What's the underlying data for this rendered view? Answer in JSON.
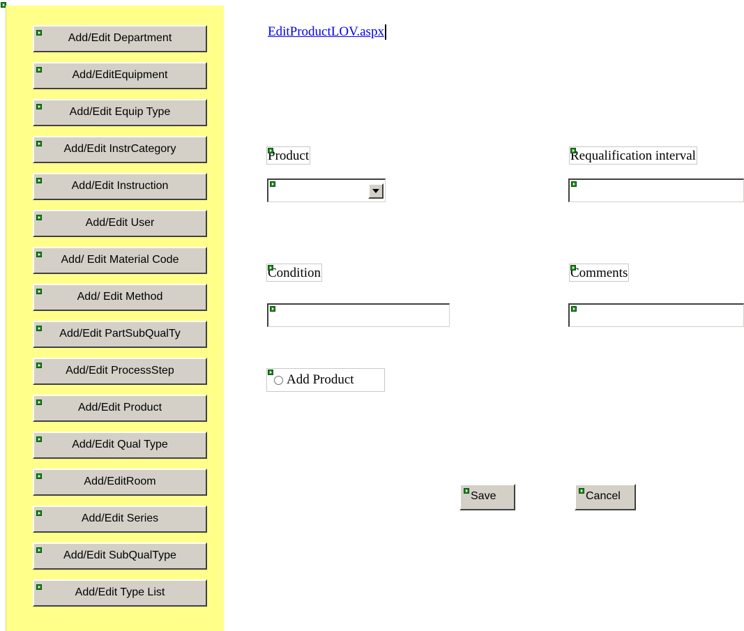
{
  "sidebar": {
    "items": [
      {
        "label": "Add/Edit Department"
      },
      {
        "label": "Add/EditEquipment"
      },
      {
        "label": "Add/Edit Equip Type"
      },
      {
        "label": "Add/Edit InstrCategory"
      },
      {
        "label": "Add/Edit Instruction"
      },
      {
        "label": "Add/Edit User"
      },
      {
        "label": "Add/ Edit Material Code"
      },
      {
        "label": "Add/ Edit Method"
      },
      {
        "label": "Add/Edit PartSubQualTy"
      },
      {
        "label": "Add/Edit ProcessStep"
      },
      {
        "label": "Add/Edit Product"
      },
      {
        "label": "Add/Edit Qual Type"
      },
      {
        "label": "Add/EditRoom"
      },
      {
        "label": "Add/Edit Series"
      },
      {
        "label": "Add/Edit SubQualType"
      },
      {
        "label": "Add/Edit Type List"
      }
    ]
  },
  "link": {
    "text": "EditProductLOV.aspx"
  },
  "form": {
    "product_label": "Product",
    "product_value": "",
    "requal_label": "Requalification interval",
    "requal_value": "",
    "condition_label": "Condition",
    "condition_value": "",
    "comments_label": "Comments",
    "comments_value": "",
    "radio_label": "Add Product"
  },
  "actions": {
    "save_label": "Save",
    "cancel_label": "Cancel"
  },
  "icons": {
    "control_glyph": "control-marker-icon",
    "dropdown_arrow": "chevron-down-icon"
  }
}
